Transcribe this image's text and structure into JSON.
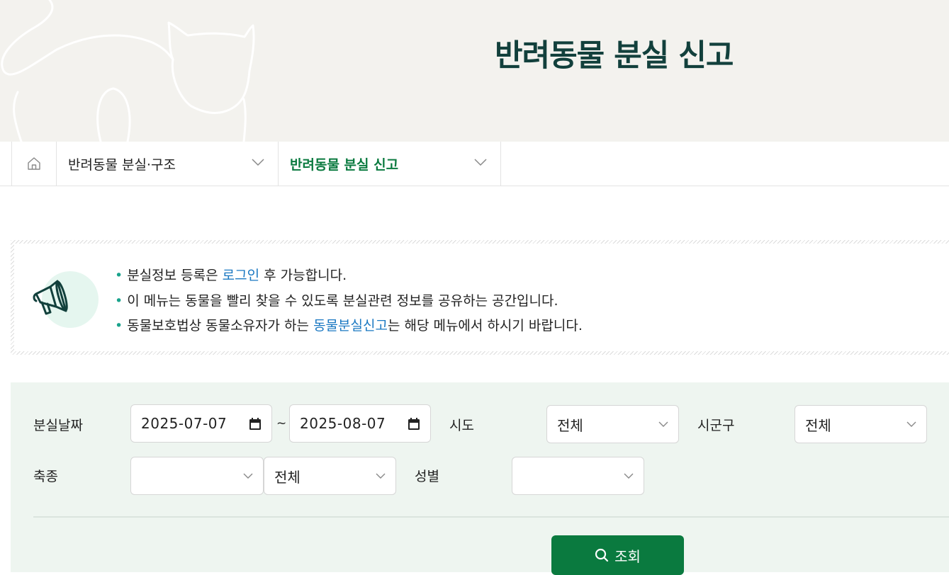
{
  "page": {
    "title": "반려동물 분실 신고"
  },
  "breadcrumb": {
    "home_icon": "home-icon",
    "items": [
      {
        "label": "반려동물 분실·구조",
        "active": false
      },
      {
        "label": "반려동물 분실 신고",
        "active": true
      }
    ]
  },
  "notice": {
    "icon": "megaphone-icon",
    "lines": [
      {
        "before": "분실정보 등록은 ",
        "link": "로그인",
        "after": " 후 가능합니다."
      },
      {
        "before": "이 메뉴는 동물을 빨리 찾을 수 있도록 분실관련 정보를 공유하는 공간입니다.",
        "link": "",
        "after": ""
      },
      {
        "before": "동물보호법상 동물소유자가 하는 ",
        "link": "동물분실신고",
        "after": "는 해당 메뉴에서 하시기 바랍니다."
      }
    ]
  },
  "search": {
    "date_label": "분실날짜",
    "date_from": "2025-07-07",
    "date_sep": "~",
    "date_to": "2025-08-07",
    "sido_label": "시도",
    "sido_value": "전체",
    "sigungu_label": "시군구",
    "sigungu_value": "전체",
    "species_label": "축종",
    "species_value": "",
    "breed_value": "전체",
    "gender_label": "성별",
    "gender_value": "",
    "submit_label": "조회"
  },
  "colors": {
    "accent": "#0a7a3f",
    "title": "#12403c",
    "link": "#1a78c2",
    "search_bg": "#eef5f0",
    "hero_bg": "#f3f2ee"
  }
}
